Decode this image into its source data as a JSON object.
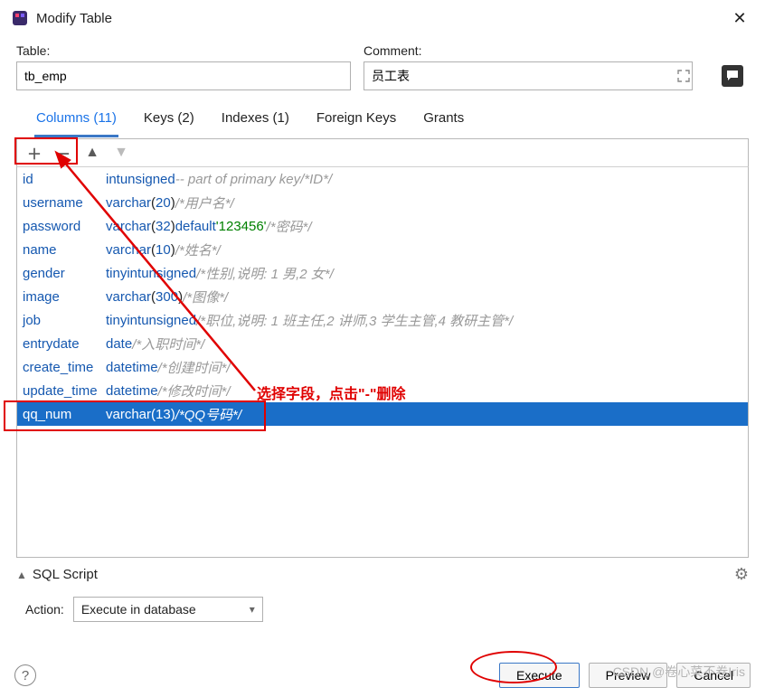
{
  "window": {
    "title": "Modify Table"
  },
  "form": {
    "table_label": "Table:",
    "table_value": "tb_emp",
    "comment_label": "Comment:",
    "comment_value": "员工表"
  },
  "tabs": [
    {
      "label": "Columns (11)",
      "active": true
    },
    {
      "label": "Keys (2)"
    },
    {
      "label": "Indexes (1)"
    },
    {
      "label": "Foreign Keys"
    },
    {
      "label": "Grants"
    }
  ],
  "columns": [
    {
      "name": "id",
      "type": "int unsigned",
      "extra": " -- part of primary key ",
      "comment": "/*ID*/"
    },
    {
      "name": "username",
      "type": "varchar(20)",
      "comment": "/*用户名*/"
    },
    {
      "name": "password",
      "type": "varchar(32)",
      "default": "'123456'",
      "comment": "/*密码*/"
    },
    {
      "name": "name",
      "type": "varchar(10)",
      "comment": "/*姓名*/"
    },
    {
      "name": "gender",
      "type": "tinyint unsigned",
      "comment": "/*性别,说明: 1 男,2 女*/"
    },
    {
      "name": "image",
      "type": "varchar(300)",
      "comment": "/*图像*/"
    },
    {
      "name": "job",
      "type": "tinyint unsigned",
      "comment": "/*职位,说明: 1 班主任,2 讲师,3 学生主管,4 教研主管*/"
    },
    {
      "name": "entrydate",
      "type": "date",
      "comment": "/*入职时间*/"
    },
    {
      "name": "create_time",
      "type": "datetime",
      "comment": "/*创建时间*/"
    },
    {
      "name": "update_time",
      "type": "datetime",
      "comment": "/*修改时间*/"
    },
    {
      "name": "qq_num",
      "type": "varchar(13)",
      "comment": "/*QQ号码*/",
      "selected": true
    }
  ],
  "annotation": {
    "text": "选择字段，点击\"-\"删除"
  },
  "sql": {
    "title": "SQL Script"
  },
  "action": {
    "label": "Action:",
    "value": "Execute in database"
  },
  "buttons": {
    "execute": "Execute",
    "preview": "Preview",
    "cancel": "Cancel"
  },
  "watermark": "CSDN @卷心菜不卷Iris"
}
